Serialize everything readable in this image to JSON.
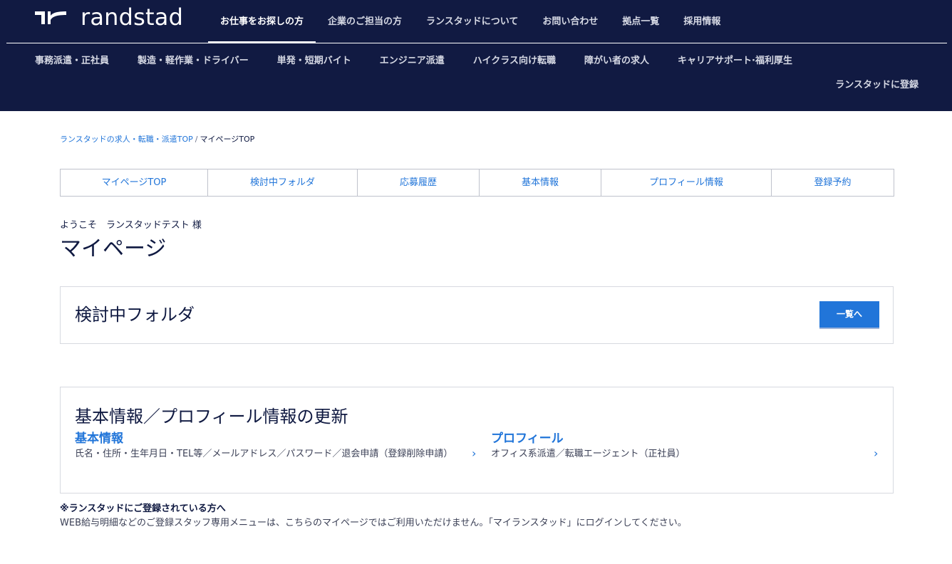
{
  "header": {
    "logo_text": "randstad",
    "main_nav": [
      {
        "label": "お仕事をお探しの方",
        "active": true
      },
      {
        "label": "企業のご担当の方"
      },
      {
        "label": "ランスタッドについて"
      },
      {
        "label": "お問い合わせ"
      },
      {
        "label": "拠点一覧"
      },
      {
        "label": "採用情報"
      }
    ],
    "sub_nav": [
      {
        "label": "事務派遣・正社員"
      },
      {
        "label": "製造・軽作業・ドライバー"
      },
      {
        "label": "単発・短期バイト"
      },
      {
        "label": "エンジニア派遣"
      },
      {
        "label": "ハイクラス向け転職"
      },
      {
        "label": "障がい者の求人"
      },
      {
        "label": "キャリアサポート·福利厚生"
      }
    ],
    "register_label": "ランスタッドに登録"
  },
  "breadcrumb": {
    "home": "ランスタッドの求人・転職・派遣TOP",
    "separator": "/",
    "current": "マイページTOP"
  },
  "tabs": [
    {
      "label": "マイページTOP"
    },
    {
      "label": "検討中フォルダ"
    },
    {
      "label": "応募履歴"
    },
    {
      "label": "基本情報"
    },
    {
      "label": "プロフィール情報"
    },
    {
      "label": "登録予約"
    }
  ],
  "welcome": "ようこそ　ランスタッドテスト 様",
  "page_title": "マイページ",
  "folder_card": {
    "title": "検討中フォルダ",
    "button_label": "一覧へ"
  },
  "info_card": {
    "title": "基本情報／プロフィール情報の更新",
    "basic": {
      "title": "基本情報",
      "description": "氏名・住所・生年月日・TEL等／メールアドレス／パスワード／退会申請（登録削除申請）"
    },
    "profile": {
      "title": "プロフィール",
      "description": "オフィス系派遣／転職エージェント（正社員）"
    },
    "chevron_glyph": "›"
  },
  "note": {
    "title": "※ランスタッドにご登録されている方へ",
    "text": "WEB給与明細などのご登録スタッフ専用メニューは、こちらのマイページではご利用いただけません。「マイランスタッド」にログインしてください。"
  },
  "colors": {
    "header_bg": "#111a42",
    "accent": "#2175d9",
    "text": "#0f1941",
    "border": "#bfc2cc"
  },
  "icons": {
    "logo": "randstad-logo-icon",
    "chevron": "chevron-right-icon"
  }
}
